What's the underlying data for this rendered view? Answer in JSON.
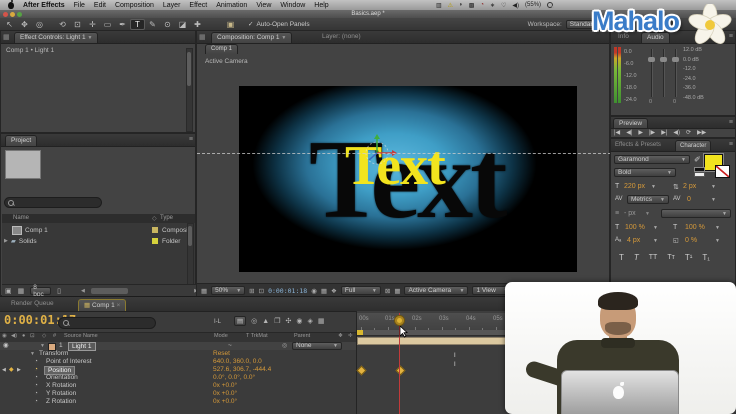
{
  "menubar": {
    "items": [
      "After Effects",
      "File",
      "Edit",
      "Composition",
      "Layer",
      "Effect",
      "Animation",
      "View",
      "Window",
      "Help"
    ],
    "status_icons": [
      "▥",
      "⚠",
      "◗",
      "▩",
      "◔",
      "∗",
      "♡",
      "◀)"
    ],
    "battery": "(55%)"
  },
  "titlebar": {
    "title": "Basics.aep *"
  },
  "toolbar": {
    "tools": [
      "↖",
      "✥",
      "◎",
      "⟲",
      "⊡",
      "✛",
      "▭",
      "✒",
      "T",
      "✎",
      "⊙",
      "◪",
      "✚"
    ],
    "auto_open": "Auto-Open Panels",
    "workspace_label": "Workspace:",
    "workspace_value": "Standard"
  },
  "effect_controls": {
    "tab": "Effect Controls: Light 1",
    "breadcrumb": "Comp 1 • Light 1"
  },
  "project": {
    "tab": "Project",
    "col_name": "Name",
    "col_type": "Type",
    "rows": [
      {
        "name": "Comp 1",
        "type": "Composi"
      },
      {
        "name": "Solids",
        "type": "Folder"
      }
    ],
    "bpc": "8 bpc"
  },
  "composition": {
    "tab_comp": "Composition: Comp 1",
    "tab_layer": "Layer: (none)",
    "breadcrumb": "Comp 1",
    "camera": "Active Camera",
    "text_black": "Text",
    "text_yellow": "Text",
    "zoom": "50%",
    "timecode": "0:00:01:18",
    "resolution": "Full",
    "view": "Active Camera",
    "views": "1 View"
  },
  "audio": {
    "tab_info": "Info",
    "tab_audio": "Audio",
    "left_scale": [
      "0.0",
      "-6.0",
      "-12.0",
      "-18.0",
      "-24.0"
    ],
    "right_scale": [
      "12.0 dB",
      "0.0 dB",
      "-12.0",
      "-24.0",
      "-36.0",
      "-48.0 dB"
    ],
    "zero": "0"
  },
  "preview": {
    "tab": "Preview",
    "buttons": [
      "|◀",
      "◀|",
      "▶",
      "|▶",
      "▶|",
      "◀)",
      "⟳",
      "▶▶"
    ]
  },
  "character": {
    "tab_effects": "Effects & Presets",
    "tab_char": "Character",
    "font": "Garamond",
    "style": "Bold",
    "size": "220 px",
    "leading": "2 px",
    "kerning": "Metrics",
    "tracking": "0",
    "stroke_width": "- px",
    "v_scale": "100 %",
    "h_scale": "100 %",
    "baseline": "4 px",
    "tsume": "0 %",
    "faux": [
      "T",
      "T",
      "TT",
      "Tт",
      "T¹",
      "T₁"
    ]
  },
  "timeline": {
    "tab_render": "Render Queue",
    "tab_comp": "Comp 1",
    "timecode": "0:00:01:17",
    "inout": "I-L",
    "col_source": "Source Name",
    "col_mode": "Mode",
    "col_trkmat": "T TrkMat",
    "col_parent": "Parent",
    "layer_num": "1",
    "layer_name": "Light 1",
    "mode_value": "~",
    "parent_value": "None",
    "transform": {
      "name": "Transform",
      "value": "Reset"
    },
    "props": [
      {
        "name": "Point of Interest",
        "value": "640.0, 360.0, 0.0"
      },
      {
        "name": "Position",
        "value": "527.6, 306.7, -444.4"
      },
      {
        "name": "Orientation",
        "value": "0.0°, 0.0°, 0.0°"
      },
      {
        "name": "X Rotation",
        "value": "0x +0.0°"
      },
      {
        "name": "Y Rotation",
        "value": "0x +0.0°"
      },
      {
        "name": "Z Rotation",
        "value": "0x +0.0°"
      }
    ],
    "ruler": [
      "00s",
      "01s",
      "02s",
      "03s",
      "04s",
      "05s"
    ]
  },
  "watermark": {
    "text": "Mahalo"
  },
  "colors": {
    "accent_orange": "#d69a3a",
    "keyframe_gold": "#e3b341",
    "workarea_tan": "#dcc9a0",
    "viewport_blue": "#3f9ec6",
    "text_yellow": "#f2e41e",
    "mahalo_blue": "#3a7cc8"
  }
}
